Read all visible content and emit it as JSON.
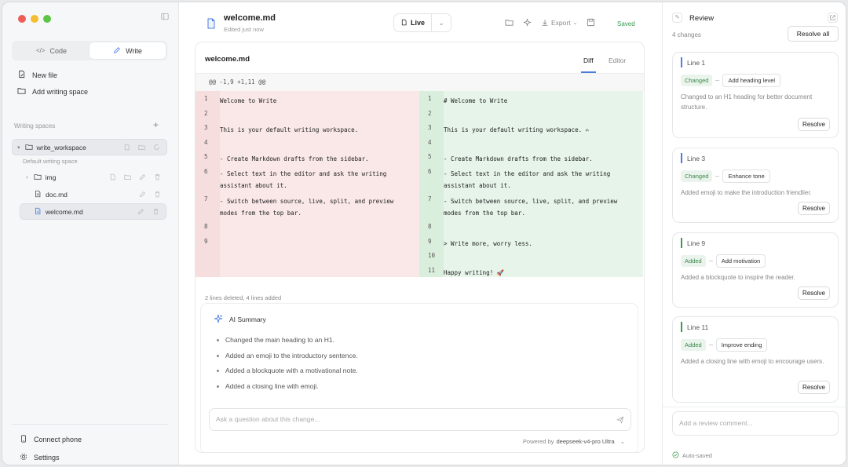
{
  "sidebar": {
    "mode_tabs": [
      {
        "label": "Code"
      },
      {
        "label": "Write"
      }
    ],
    "new_file": "New file",
    "add_space": "Add writing space",
    "spaces_heading": "Writing spaces",
    "workspace": {
      "name": "write_workspace",
      "description": "Default writing space"
    },
    "files": [
      {
        "name": "img"
      },
      {
        "name": "doc.md"
      },
      {
        "name": "welcome.md"
      }
    ],
    "connect_phone": "Connect phone",
    "settings": "Settings"
  },
  "header": {
    "title": "welcome.md",
    "subtitle": "Edited just now",
    "mode": "Live",
    "export_label": "Export",
    "status": "Saved"
  },
  "editor": {
    "file_title": "welcome.md",
    "tabs": [
      {
        "label": "Diff"
      },
      {
        "label": "Editor"
      }
    ],
    "hunk_header": "@@ -1,9 +1,11 @@",
    "left_lines": [
      {
        "n": "1",
        "text": "Welcome to Write"
      },
      {
        "n": "2",
        "text": ""
      },
      {
        "n": "3",
        "text": "This is your default writing workspace."
      },
      {
        "n": "4",
        "text": ""
      },
      {
        "n": "5",
        "text": "- Create Markdown drafts from the sidebar."
      },
      {
        "n": "6",
        "text": "- Select text in the editor and ask the writing assistant about it."
      },
      {
        "n": "7",
        "text": "- Switch between source, live, split, and preview modes from the top bar."
      },
      {
        "n": "8",
        "text": ""
      },
      {
        "n": "9",
        "text": ""
      },
      {
        "n": "",
        "text": ""
      },
      {
        "n": "",
        "text": ""
      }
    ],
    "right_lines": [
      {
        "n": "1",
        "text": "# Welcome to Write"
      },
      {
        "n": "2",
        "text": ""
      },
      {
        "n": "3",
        "text": "This is your default writing workspace. ✍"
      },
      {
        "n": "4",
        "text": ""
      },
      {
        "n": "5",
        "text": "- Create Markdown drafts from the sidebar."
      },
      {
        "n": "6",
        "text": "- Select text in the editor and ask the writing assistant about it."
      },
      {
        "n": "7",
        "text": "- Switch between source, live, split, and preview modes from the top bar."
      },
      {
        "n": "8",
        "text": ""
      },
      {
        "n": "9",
        "text": "> Write more, worry less."
      },
      {
        "n": "10",
        "text": ""
      },
      {
        "n": "11",
        "text": "Happy writing! 🚀"
      }
    ],
    "diff_stat": "2 lines deleted, 4 lines added"
  },
  "ai_summary": {
    "title": "AI Summary",
    "items": [
      "Changed the main heading to an H1.",
      "Added an emoji to the introductory sentence.",
      "Added a blockquote with a motivational note.",
      "Added a closing line with emoji."
    ],
    "ask_placeholder": "Ask a question about this change...",
    "powered_prefix": "Powered by",
    "model": "deepseek-v4-pro Ultra"
  },
  "review": {
    "title": "Review",
    "count": "4 changes",
    "resolve_all": "Resolve all",
    "resolve_label": "Resolve",
    "cards": [
      {
        "line": "Line 1",
        "kind": "Changed",
        "tag": "Add heading level",
        "desc": "Changed to an H1 heading for better document structure."
      },
      {
        "line": "Line 3",
        "kind": "Changed",
        "tag": "Enhance tone",
        "desc": "Added emoji to make the introduction friendlier."
      },
      {
        "line": "Line 9",
        "kind": "Added",
        "tag": "Add motivation",
        "desc": "Added a blockquote to inspire the reader."
      },
      {
        "line": "Line 11",
        "kind": "Added",
        "tag": "Improve ending",
        "desc": "Added a closing line with emoji to encourage users."
      }
    ],
    "comment_placeholder": "Add a review comment...",
    "autosaved": "Auto-saved"
  }
}
